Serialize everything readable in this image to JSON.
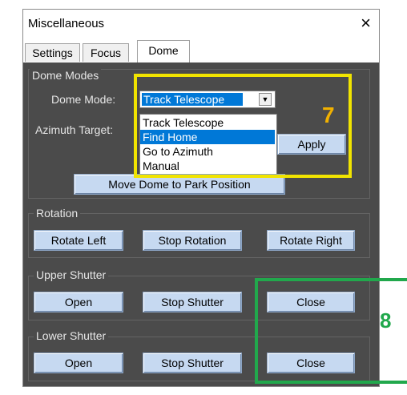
{
  "window": {
    "title": "Miscellaneous",
    "close_glyph": "×"
  },
  "tabs": [
    {
      "label": "Settings"
    },
    {
      "label": "Focus"
    },
    {
      "label": "Dome",
      "active": true
    }
  ],
  "dome_modes": {
    "group_label": "Dome Modes",
    "mode_label": "Dome Mode:",
    "mode_value": "Track Telescope",
    "azimuth_label": "Azimuth Target:",
    "apply": "Apply",
    "park": "Move Dome to Park Position",
    "options": [
      "Track Telescope",
      "Find Home",
      "Go to Azimuth",
      "Manual"
    ],
    "highlighted_option": "Find Home"
  },
  "rotation": {
    "group_label": "Rotation",
    "left": "Rotate Left",
    "stop": "Stop Rotation",
    "right": "Rotate Right"
  },
  "upper_shutter": {
    "group_label": "Upper Shutter",
    "open": "Open",
    "stop": "Stop Shutter",
    "close": "Close"
  },
  "lower_shutter": {
    "group_label": "Lower Shutter",
    "open": "Open",
    "stop": "Stop Shutter",
    "close": "Close"
  },
  "annotations": {
    "box7": "7",
    "box8": "8",
    "box7_color": "#f1e400",
    "box8_color": "#21a84c"
  },
  "colors": {
    "panel": "#4b4b4b",
    "button": "#c6d9f1",
    "selection": "#0078d7"
  }
}
